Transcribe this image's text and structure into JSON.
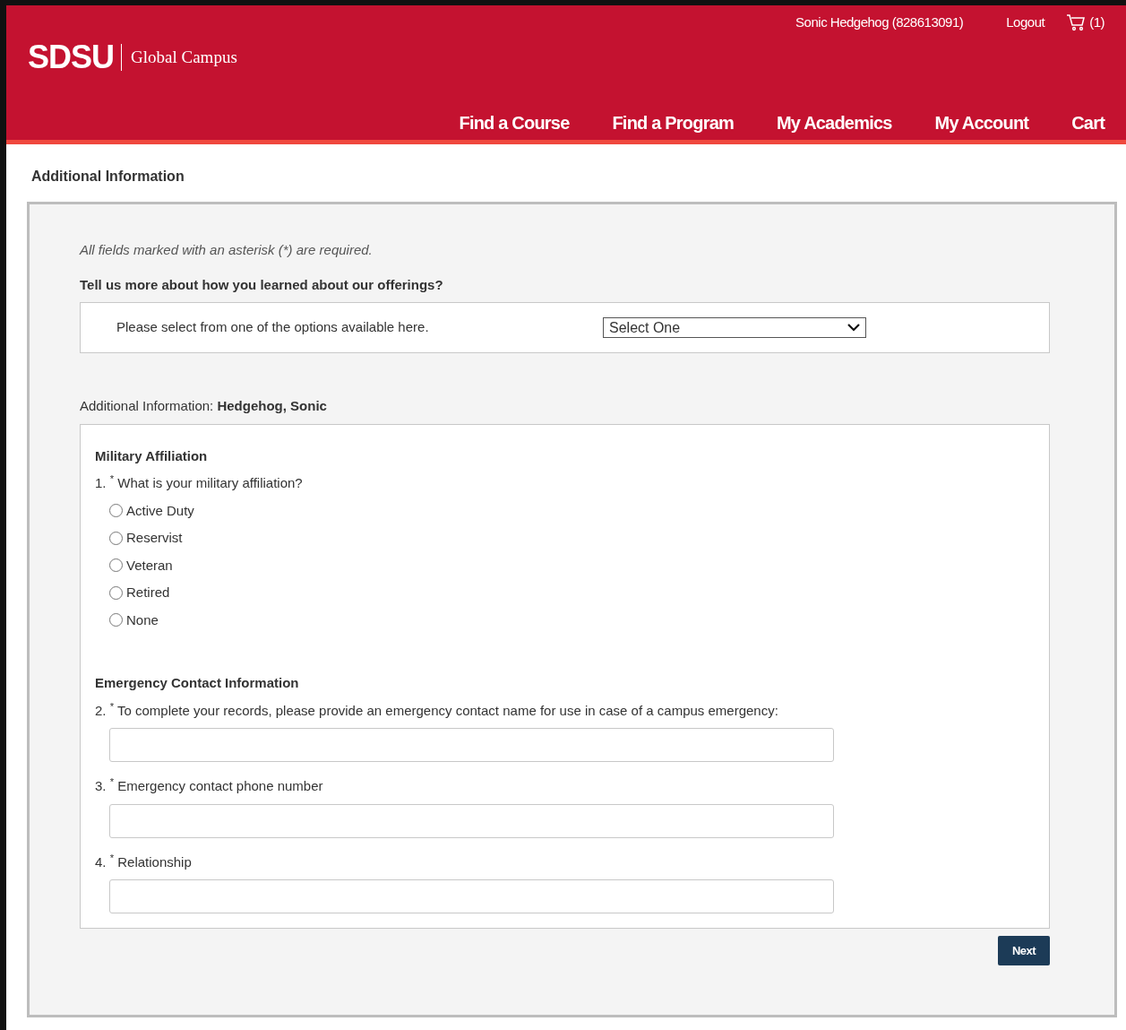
{
  "header": {
    "logo": "SDSU",
    "logo_subtitle": "Global Campus",
    "user": "Sonic Hedgehog (828613091)",
    "logout": "Logout",
    "cart_count": "(1)",
    "nav": [
      "Find a Course",
      "Find a Program",
      "My Academics",
      "My Account",
      "Cart"
    ]
  },
  "page_title": "Additional Information",
  "required_note": "All fields marked with an asterisk (*) are required.",
  "offerings": {
    "question": "Tell us more about how you learned about our offerings?",
    "prompt": "Please select from one of the options available here.",
    "select_value": "Select One"
  },
  "person_label": "Additional Information:",
  "person_name": "Hedgehog, Sonic",
  "sections": [
    {
      "title": "Military Affiliation",
      "questions": [
        {
          "kind": "radio",
          "number": "1.",
          "text": "$^{*}$ What is your military affiliation?",
          "options": [
            {
              "label": "Active Duty",
              "selected": false
            },
            {
              "label": "Reservist",
              "selected": false
            },
            {
              "label": "Veteran",
              "selected": false
            },
            {
              "label": "Retired",
              "selected": false
            },
            {
              "label": "None",
              "selected": false
            }
          ]
        }
      ]
    },
    {
      "title": "Emergency Contact Information",
      "questions": [
        {
          "kind": "text",
          "number": "2.",
          "text": "$^{*}$ To complete your records, please provide an emergency contact name for use in case of a campus emergency:"
        },
        {
          "kind": "text",
          "number": "3.",
          "text": "$^{*}$ Emergency contact phone number"
        },
        {
          "kind": "text",
          "number": "4.",
          "text": "$^{*}$ Relationship"
        }
      ]
    }
  ],
  "next_button": "Next"
}
